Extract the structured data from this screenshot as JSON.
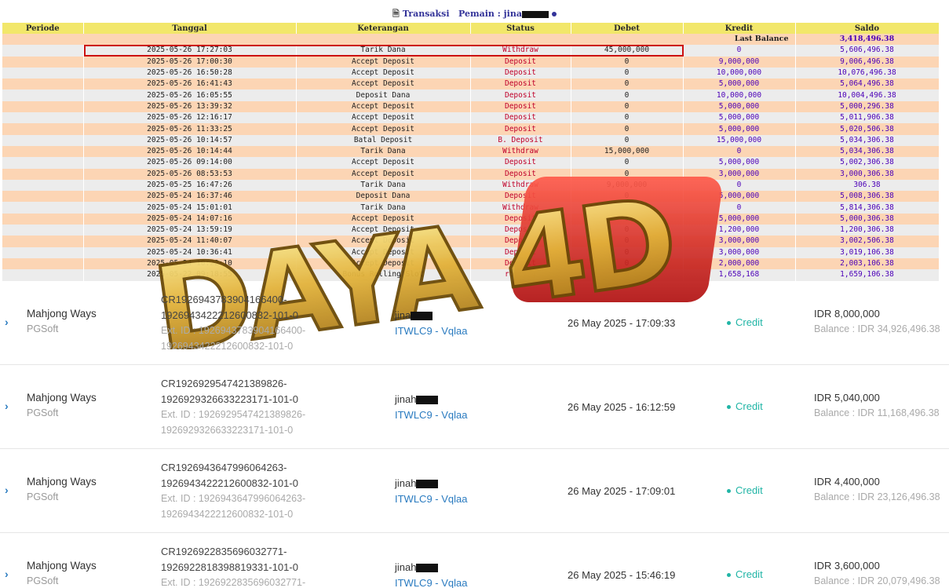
{
  "header": {
    "title": "Transaksi",
    "player_label": "Pemain :",
    "player_name": "jina",
    "icon": "document-icon"
  },
  "table": {
    "columns": [
      "Periode",
      "Tanggal",
      "Keterangan",
      "Status",
      "Debet",
      "Kredit",
      "Saldo"
    ],
    "last_balance_label": "Last Balance",
    "last_balance_value": "3,418,496.38",
    "rows": [
      {
        "tanggal": "2025-05-26 17:27:03",
        "ket": "Tarik Dana",
        "status": "Withdraw",
        "debet": "45,000,000",
        "kredit": "0",
        "saldo": "5,606,496.38"
      },
      {
        "tanggal": "2025-05-26 17:00:30",
        "ket": "Accept Deposit",
        "status": "Deposit",
        "debet": "0",
        "kredit": "9,000,000",
        "saldo": "9,006,496.38"
      },
      {
        "tanggal": "2025-05-26 16:50:28",
        "ket": "Accept Deposit",
        "status": "Deposit",
        "debet": "0",
        "kredit": "10,000,000",
        "saldo": "10,076,496.38"
      },
      {
        "tanggal": "2025-05-26 16:41:43",
        "ket": "Accept Deposit",
        "status": "Deposit",
        "debet": "0",
        "kredit": "5,000,000",
        "saldo": "5,064,496.38"
      },
      {
        "tanggal": "2025-05-26 16:05:55",
        "ket": "Deposit Dana",
        "status": "Deposit",
        "debet": "0",
        "kredit": "10,000,000",
        "saldo": "10,004,496.38"
      },
      {
        "tanggal": "2025-05-26 13:39:32",
        "ket": "Accept Deposit",
        "status": "Deposit",
        "debet": "0",
        "kredit": "5,000,000",
        "saldo": "5,000,296.38"
      },
      {
        "tanggal": "2025-05-26 12:16:17",
        "ket": "Accept Deposit",
        "status": "Deposit",
        "debet": "0",
        "kredit": "5,000,000",
        "saldo": "5,011,906.38"
      },
      {
        "tanggal": "2025-05-26 11:33:25",
        "ket": "Accept Deposit",
        "status": "Deposit",
        "debet": "0",
        "kredit": "5,000,000",
        "saldo": "5,020,506.38"
      },
      {
        "tanggal": "2025-05-26 10:14:57",
        "ket": "Batal Deposit",
        "status": "B. Deposit",
        "debet": "0",
        "kredit": "15,000,000",
        "saldo": "5,034,306.38"
      },
      {
        "tanggal": "2025-05-26 10:14:44",
        "ket": "Tarik Dana",
        "status": "Withdraw",
        "debet": "15,000,000",
        "kredit": "0",
        "saldo": "5,034,306.38"
      },
      {
        "tanggal": "2025-05-26 09:14:00",
        "ket": "Accept Deposit",
        "status": "Deposit",
        "debet": "0",
        "kredit": "5,000,000",
        "saldo": "5,002,306.38"
      },
      {
        "tanggal": "2025-05-26 08:53:53",
        "ket": "Accept Deposit",
        "status": "Deposit",
        "debet": "0",
        "kredit": "3,000,000",
        "saldo": "3,000,306.38"
      },
      {
        "tanggal": "2025-05-25 16:47:26",
        "ket": "Tarik Dana",
        "status": "Withdraw",
        "debet": "9,000,000",
        "kredit": "0",
        "saldo": "306.38"
      },
      {
        "tanggal": "2025-05-24 16:37:46",
        "ket": "Deposit Dana",
        "status": "Deposit",
        "debet": "0",
        "kredit": "5,000,000",
        "saldo": "5,008,306.38"
      },
      {
        "tanggal": "2025-05-24 15:01:01",
        "ket": "Tarik Dana",
        "status": "Withdraw",
        "debet": "35,000,000",
        "kredit": "0",
        "saldo": "5,814,306.38"
      },
      {
        "tanggal": "2025-05-24 14:07:16",
        "ket": "Accept Deposit",
        "status": "Deposit",
        "debet": "0",
        "kredit": "5,000,000",
        "saldo": "5,000,306.38"
      },
      {
        "tanggal": "2025-05-24 13:59:19",
        "ket": "Accept Deposit",
        "status": "Deposit",
        "debet": "0",
        "kredit": "1,200,000",
        "saldo": "1,200,306.38"
      },
      {
        "tanggal": "2025-05-24 11:40:07",
        "ket": "Accept Deposit",
        "status": "Deposit",
        "debet": "0",
        "kredit": "3,000,000",
        "saldo": "3,002,506.38"
      },
      {
        "tanggal": "2025-05-24 10:36:41",
        "ket": "Accept Deposit",
        "status": "Deposit",
        "debet": "0",
        "kredit": "3,000,000",
        "saldo": "3,019,106.38"
      },
      {
        "tanggal": "2025-05-24 10:22:10",
        "ket": "Accept Deposit",
        "status": "Deposit",
        "debet": "0",
        "kredit": "2,000,000",
        "saldo": "2,003,106.38"
      },
      {
        "tanggal": "2025-05-22 09:18:55",
        "ket": "Bonus Rolling Slot",
        "status": "rolling",
        "debet": "0",
        "kredit": "1,658,168",
        "saldo": "1,659,106.38"
      }
    ]
  },
  "watermark": {
    "text": "DAYA 4D"
  },
  "history": [
    {
      "game": "Mahjong Ways",
      "provider": "PGSoft",
      "cr1": "CR1926943783904166400-",
      "cr2": "1926943422212600832-101-0",
      "ext1": "Ext. ID : 1926943783904166400-",
      "ext2": "1926943422212600832-101-0",
      "user": "jina",
      "agent": "ITWLC9 - Vqlaa",
      "date": "26 May 2025 - 17:09:33",
      "type": "Credit",
      "amount": "IDR 8,000,000",
      "balance": "Balance : IDR 34,926,496.38"
    },
    {
      "game": "Mahjong Ways",
      "provider": "PGSoft",
      "cr1": "CR1926929547421389826-",
      "cr2": "1926929326633223171-101-0",
      "ext1": "Ext. ID : 1926929547421389826-",
      "ext2": "1926929326633223171-101-0",
      "user": "jinah",
      "agent": "ITWLC9 - Vqlaa",
      "date": "26 May 2025 - 16:12:59",
      "type": "Credit",
      "amount": "IDR 5,040,000",
      "balance": "Balance : IDR 11,168,496.38"
    },
    {
      "game": "Mahjong Ways",
      "provider": "PGSoft",
      "cr1": "CR1926943647996064263-",
      "cr2": "1926943422212600832-101-0",
      "ext1": "Ext. ID : 1926943647996064263-",
      "ext2": "1926943422212600832-101-0",
      "user": "jinah",
      "agent": "ITWLC9 - Vqlaa",
      "date": "26 May 2025 - 17:09:01",
      "type": "Credit",
      "amount": "IDR 4,400,000",
      "balance": "Balance : IDR 23,126,496.38"
    },
    {
      "game": "Mahjong Ways",
      "provider": "PGSoft",
      "cr1": "CR1926922835696032771-",
      "cr2": "1926922818398819331-101-0",
      "ext1": "Ext. ID : 1926922835696032771-",
      "ext2": "",
      "user": "jinah",
      "agent": "ITWLC9 - Vqlaa",
      "date": "26 May 2025 - 15:46:19",
      "type": "Credit",
      "amount": "IDR 3,600,000",
      "balance": "Balance : IDR 20,079,496.38"
    }
  ]
}
